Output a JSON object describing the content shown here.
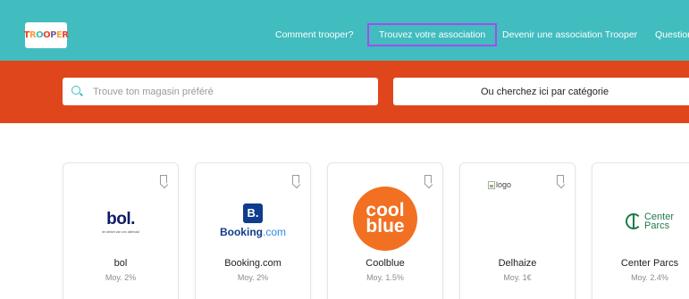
{
  "header": {
    "logo_text": [
      "T",
      "R",
      "O",
      "O",
      "P",
      "E",
      "R"
    ],
    "nav": [
      {
        "label": "Comment trooper?"
      },
      {
        "label": "Trouvez votre association"
      },
      {
        "label": "Devenir une association Trooper"
      },
      {
        "label": "Question"
      }
    ]
  },
  "search": {
    "placeholder": "Trouve ton magasin préféré",
    "category_button": "Ou cherchez ici par catégorie"
  },
  "colors": {
    "teal": "#41bcbf",
    "orange": "#e0461b",
    "focus_outline": "#a24df0"
  },
  "stores": [
    {
      "name": "bol",
      "average": "Moy. 2%",
      "logo_text": "bol.",
      "logo_tagline": "de winkel van ons allemaal"
    },
    {
      "name": "Booking.com",
      "average": "Moy. 2%",
      "logo_mark": "B.",
      "logo_text_main": "Booking",
      "logo_text_suffix": ".com"
    },
    {
      "name": "Coolblue",
      "average": "Moy. 1.5%",
      "logo_line1": "cool",
      "logo_line2": "blue"
    },
    {
      "name": "Delhaize",
      "average": "Moy. 1€",
      "logo_alt": "logo"
    },
    {
      "name": "Center Parcs",
      "average": "Moy. 2.4%",
      "logo_line1": "Center",
      "logo_line2": "Parcs"
    }
  ]
}
